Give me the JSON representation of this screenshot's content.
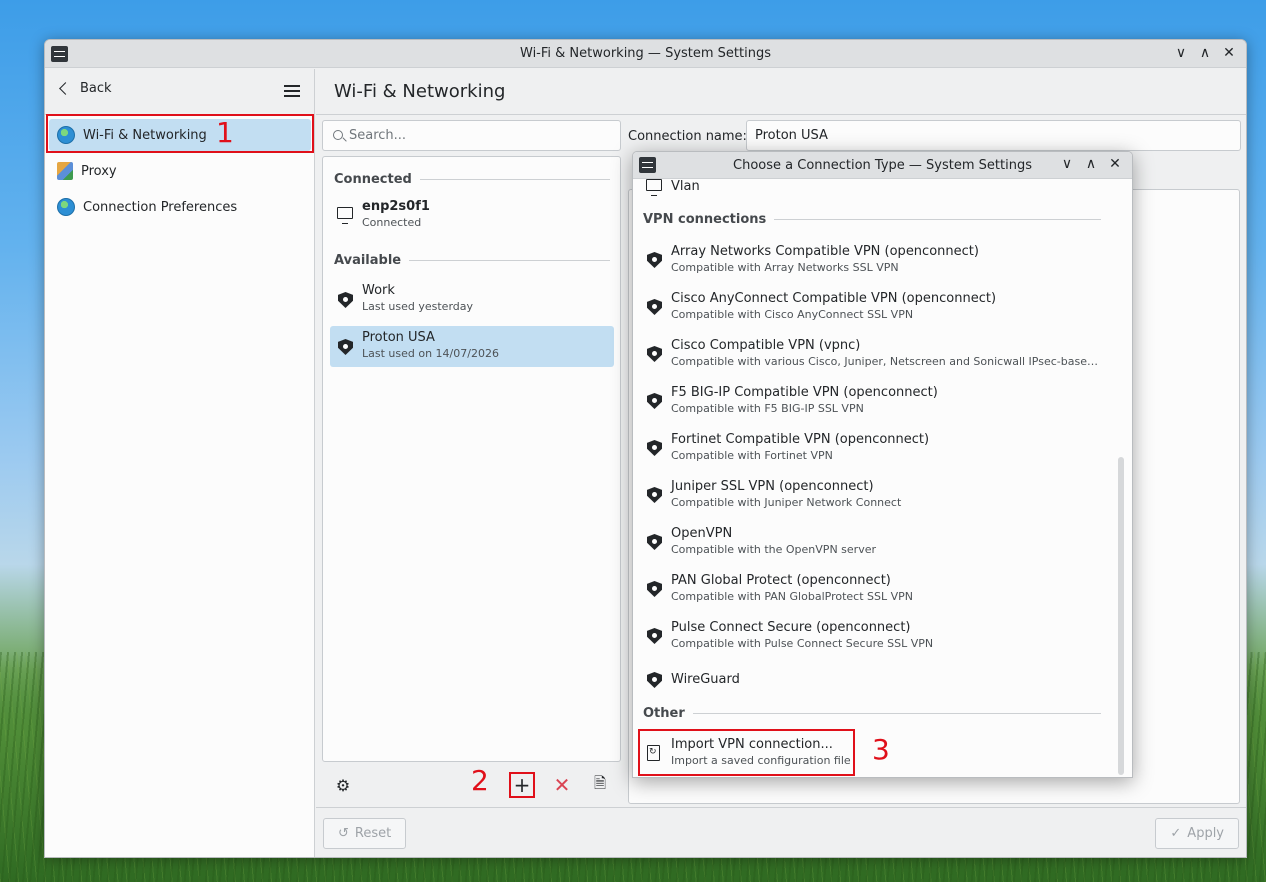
{
  "window": {
    "title": "Wi-Fi & Networking — System Settings"
  },
  "sidebar": {
    "back_label": "Back",
    "items": [
      {
        "label": "Wi-Fi & Networking",
        "icon": "globe-icon",
        "active": true
      },
      {
        "label": "Proxy",
        "icon": "proxy-icon"
      },
      {
        "label": "Connection Preferences",
        "icon": "globe-icon"
      }
    ]
  },
  "page": {
    "title": "Wi-Fi & Networking"
  },
  "search": {
    "placeholder": "Search..."
  },
  "connections": {
    "connected_label": "Connected",
    "available_label": "Available",
    "connected": [
      {
        "name": "enp2s0f1",
        "status": "Connected",
        "icon": "wired-icon"
      }
    ],
    "available": [
      {
        "name": "Work",
        "status": "Last used yesterday",
        "icon": "vpn-shield-icon"
      },
      {
        "name": "Proton USA",
        "status": "Last used on 14/07/2026",
        "icon": "vpn-shield-icon",
        "selected": true
      }
    ]
  },
  "editor": {
    "name_label": "Connection name:",
    "name_value": "Proton USA"
  },
  "footer": {
    "reset_label": "Reset",
    "apply_label": "Apply"
  },
  "annotations": {
    "one": "1",
    "two": "2",
    "three": "3",
    "color": "#e0101a"
  },
  "dialog": {
    "title": "Choose a Connection Type — System Settings",
    "partial_item": "Vlan",
    "vpn_section": "VPN connections",
    "vpn_items": [
      {
        "name": "Array Networks Compatible VPN (openconnect)",
        "desc": "Compatible with Array Networks SSL VPN"
      },
      {
        "name": "Cisco AnyConnect Compatible VPN (openconnect)",
        "desc": "Compatible with Cisco AnyConnect SSL VPN"
      },
      {
        "name": "Cisco Compatible VPN (vpnc)",
        "desc": "Compatible with various Cisco, Juniper, Netscreen and Sonicwall IPsec-based VPN ..."
      },
      {
        "name": "F5 BIG-IP Compatible VPN (openconnect)",
        "desc": "Compatible with F5 BIG-IP SSL VPN"
      },
      {
        "name": "Fortinet Compatible VPN (openconnect)",
        "desc": "Compatible with Fortinet VPN"
      },
      {
        "name": "Juniper SSL VPN (openconnect)",
        "desc": "Compatible with Juniper Network Connect"
      },
      {
        "name": "OpenVPN",
        "desc": "Compatible with the OpenVPN server"
      },
      {
        "name": "PAN Global Protect (openconnect)",
        "desc": "Compatible with PAN GlobalProtect SSL VPN"
      },
      {
        "name": "Pulse Connect Secure (openconnect)",
        "desc": "Compatible with Pulse Connect Secure SSL VPN"
      },
      {
        "name": "WireGuard",
        "desc": ""
      }
    ],
    "other_section": "Other",
    "import_item": {
      "name": "Import VPN connection...",
      "desc": "Import a saved configuration file"
    }
  }
}
